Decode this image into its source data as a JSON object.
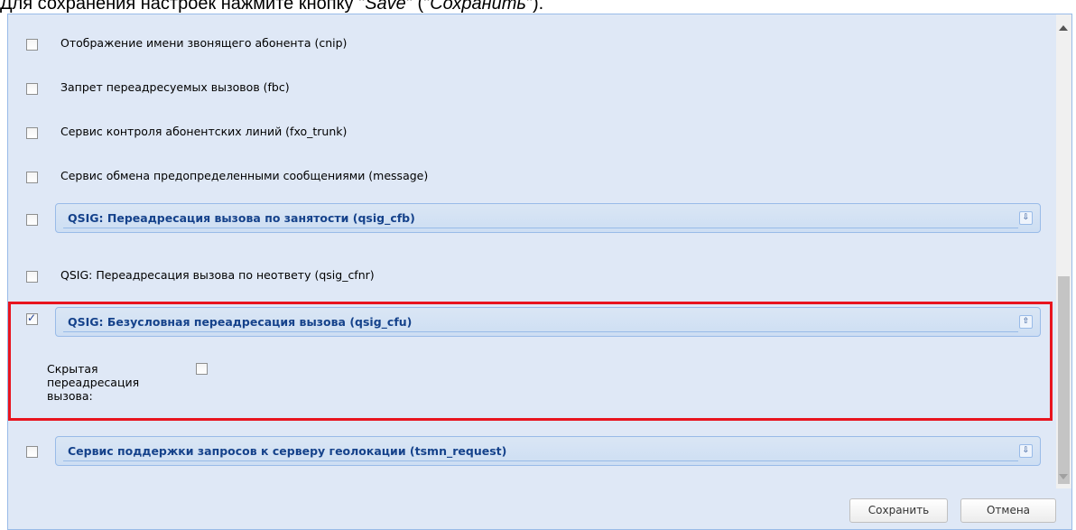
{
  "caption": {
    "before": "Для сохранения настроек нажмите кнопку \"",
    "save_en": "Save",
    "middle": "\" (\"",
    "save_ru": "Сохранить",
    "after": "\")."
  },
  "services": [
    {
      "label": "Отображение имени звонящего абонента (cnip)",
      "checked": false
    },
    {
      "label": "Запрет переадресуемых вызовов (fbc)",
      "checked": false
    },
    {
      "label": "Сервис контроля абонентских линий (fxo_trunk)",
      "checked": false
    },
    {
      "label": "Сервис обмена предопределенными сообщениями (message)",
      "checked": false
    },
    {
      "label": "QSIG: Переадресация вызова по занятости (qsig_cfb)",
      "checked": false,
      "toggle": "chevron-down"
    },
    {
      "label": "QSIG: Переадресация вызова по неответу (qsig_cfnr)",
      "checked": false
    },
    {
      "label": "QSIG: Безусловная переадресация вызова (qsig_cfu)",
      "checked": true,
      "toggle": "chevron-up"
    },
    {
      "label": "Сервис поддержки запросов к серверу геолокации (tsmn_request)",
      "checked": false,
      "toggle": "chevron-down"
    }
  ],
  "cfu_options": {
    "hidden_redirect_label": "Скрытая переадресация вызова:",
    "hidden_redirect_checked": false
  },
  "buttons": {
    "save": "Сохранить",
    "cancel": "Отмена"
  },
  "colors": {
    "panel_bg": "#dfe8f6",
    "fieldset_title": "#15428b",
    "highlight": "#e8141e"
  }
}
